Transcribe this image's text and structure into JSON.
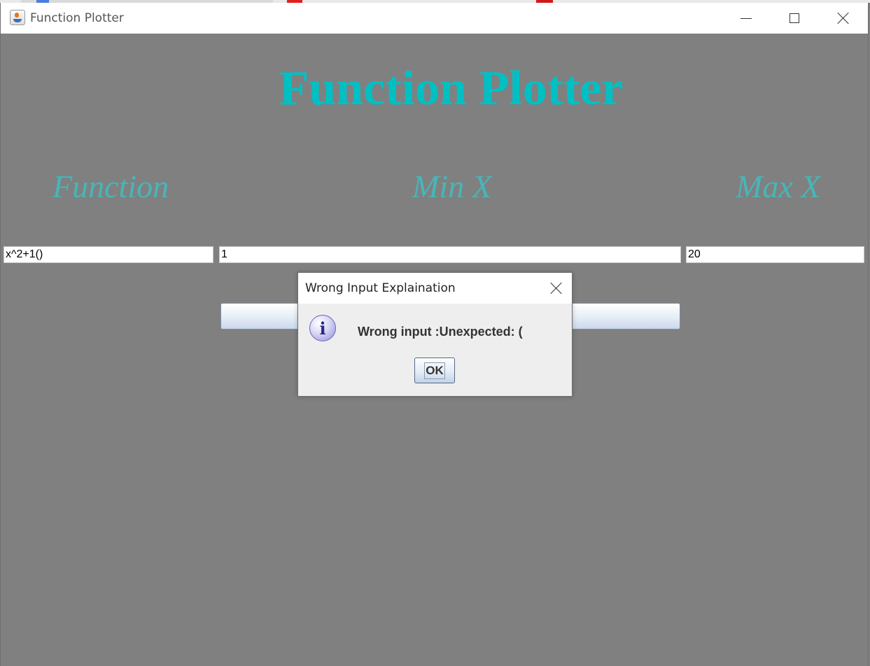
{
  "window": {
    "title": "Function Plotter",
    "minimize_icon": "minimize-icon",
    "maximize_icon": "maximize-icon",
    "close_icon": "close-icon",
    "app_icon": "java-cup-icon"
  },
  "main": {
    "heading": "Function Plotter",
    "labels": {
      "function": "Function",
      "min_x": "Min X",
      "max_x": "Max X"
    },
    "fields": {
      "function_value": "x^2+1()",
      "min_x_value": "1",
      "max_x_value": "20"
    },
    "plot_button_label": ""
  },
  "dialog": {
    "title": "Wrong Input Explaination",
    "message": "Wrong input :Unexpected: (",
    "ok_label": "OK",
    "icon": "info-icon"
  },
  "colors": {
    "background": "#808080",
    "heading": "#00c0c4",
    "labels": "#47b6b8"
  }
}
